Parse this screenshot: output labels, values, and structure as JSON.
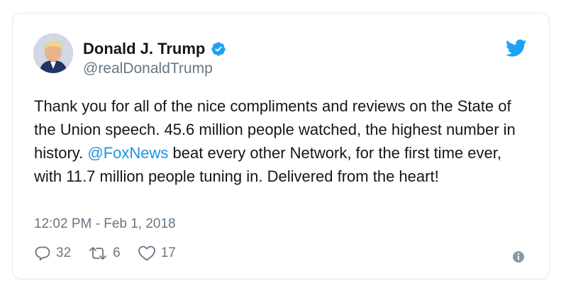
{
  "tweet": {
    "author_name": "Donald J. Trump",
    "author_handle": "@realDonaldTrump",
    "text_part1": "Thank you for all of the nice compliments and reviews on the State of the Union speech. 45.6 million people watched, the highest number in history. ",
    "mention": "@FoxNews",
    "text_part2": " beat every other Network, for the first time ever, with 11.7 million people tuning in. Delivered from the heart!",
    "timestamp": "12:02 PM - Feb 1, 2018"
  },
  "actions": {
    "replies": "32",
    "retweets": "6",
    "likes": "17"
  },
  "icons": {
    "verified": "verified-badge-icon",
    "bird": "twitter-bird-icon",
    "reply": "reply-icon",
    "retweet": "retweet-icon",
    "like": "heart-icon",
    "info": "info-icon"
  },
  "colors": {
    "accent": "#1da1f2",
    "link": "#1b95e0",
    "muted": "#657786",
    "text": "#14171a",
    "border": "#e1e8ed"
  }
}
